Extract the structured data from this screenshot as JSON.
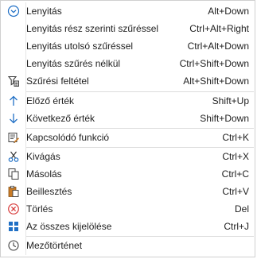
{
  "menu": {
    "items": [
      {
        "label": "Lenyitás",
        "shortcut": "Alt+Down",
        "icon": "chevron-down-circle-icon"
      },
      {
        "label": "Lenyitás rész szerinti szűréssel",
        "shortcut": "Ctrl+Alt+Right",
        "icon": ""
      },
      {
        "label": "Lenyitás utolsó szűréssel",
        "shortcut": "Ctrl+Alt+Down",
        "icon": ""
      },
      {
        "label": "Lenyitás szűrés nélkül",
        "shortcut": "Ctrl+Shift+Down",
        "icon": ""
      },
      {
        "label": "Szűrési feltétel",
        "shortcut": "Alt+Shift+Down",
        "icon": "filter-icon"
      },
      {
        "label": "Előző érték",
        "shortcut": "Shift+Up",
        "icon": "arrow-up-icon"
      },
      {
        "label": "Következő érték",
        "shortcut": "Shift+Down",
        "icon": "arrow-down-icon"
      },
      {
        "label": "Kapcsolódó funkció",
        "shortcut": "Ctrl+K",
        "icon": "related-function-icon"
      },
      {
        "label": "Kivágás",
        "shortcut": "Ctrl+X",
        "icon": "scissors-icon"
      },
      {
        "label": "Másolás",
        "shortcut": "Ctrl+C",
        "icon": "copy-icon"
      },
      {
        "label": "Beillesztés",
        "shortcut": "Ctrl+V",
        "icon": "paste-icon"
      },
      {
        "label": "Törlés",
        "shortcut": "Del",
        "icon": "delete-icon"
      },
      {
        "label": "Az összes kijelölése",
        "shortcut": "Ctrl+J",
        "icon": "select-all-icon"
      },
      {
        "label": "Mezőtörténet",
        "shortcut": "",
        "icon": "history-icon"
      }
    ]
  },
  "colors": {
    "accent_blue": "#1f6fc5",
    "delete_red": "#d83b3b",
    "paste_orange": "#c97b26"
  }
}
